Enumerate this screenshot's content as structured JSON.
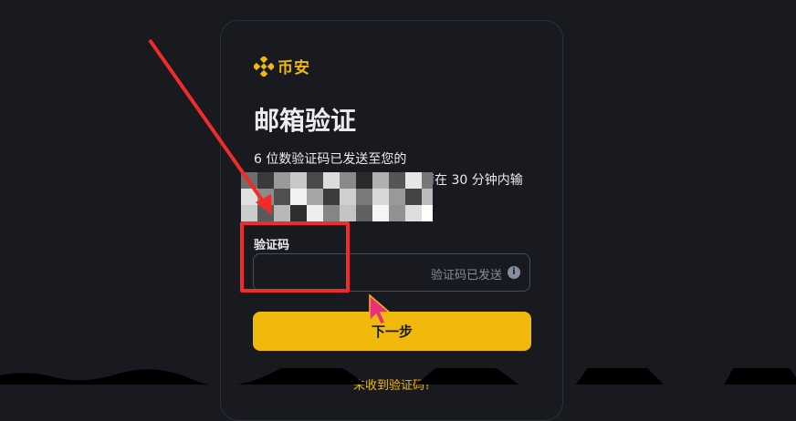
{
  "brand": {
    "name": "币安",
    "color": "#f0b90b"
  },
  "page": {
    "title": "邮箱验证",
    "description_line1": "6 位数验证码已发送至您的",
    "description_tail": "请在 30 分钟内输"
  },
  "form": {
    "code_label": "验证码",
    "code_value": "",
    "hint": "验证码已发送",
    "info_icon": "info-icon"
  },
  "actions": {
    "next_label": "下一步",
    "bottom_link": "未收到验证码?"
  },
  "annotations": {
    "highlight_color": "#ef2b2b"
  }
}
